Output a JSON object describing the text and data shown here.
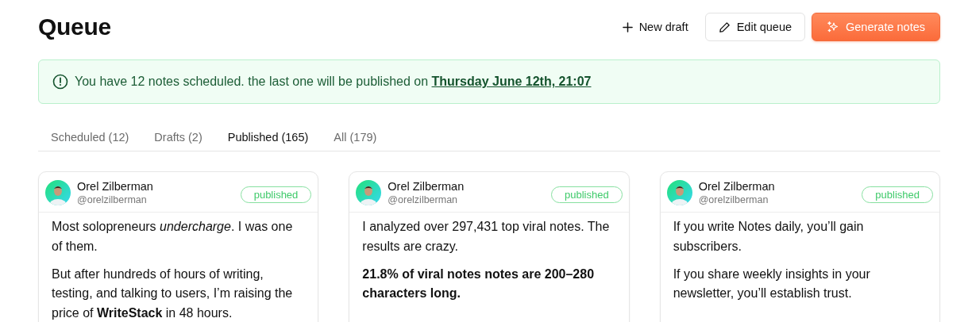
{
  "page": {
    "title": "Queue"
  },
  "actions": [
    {
      "kind": "plain",
      "label": "New draft"
    },
    {
      "kind": "outline",
      "label": "Edit queue"
    },
    {
      "kind": "primary",
      "label": "Generate notes"
    }
  ],
  "alert": {
    "text": "You have 12 notes scheduled. the last one will be published on",
    "link": "Thursday June 12th, 21:07"
  },
  "tabs": [
    {
      "label": "Scheduled (12)",
      "selected": false
    },
    {
      "label": "Drafts (2)",
      "selected": false
    },
    {
      "label": "Published (165)",
      "selected": true
    },
    {
      "label": "All (179)",
      "selected": false
    }
  ],
  "notes": [
    {
      "author": "Orel Zilberman",
      "handle": "@orelzilberman",
      "status": "published",
      "paragraphs": [
        {
          "text": "Most solopreneurs *undercharge*. I was one of them.",
          "bold": false
        },
        {
          "text": "But after hundreds of hours of writing, testing, and talking to users, I’m raising the price of **WriteStack** in 48 hours.",
          "bold": false
        }
      ]
    },
    {
      "author": "Orel Zilberman",
      "handle": "@orelzilberman",
      "status": "published",
      "paragraphs": [
        {
          "text": "I analyzed over 297,431 top viral notes. The results are crazy.",
          "bold": false
        },
        {
          "text": "21.8% of viral notes notes are 200–280 characters long.",
          "bold": true
        }
      ]
    },
    {
      "author": "Orel Zilberman",
      "handle": "@orelzilberman",
      "status": "published",
      "paragraphs": [
        {
          "text": "If you write Notes daily, you’ll gain subscribers.",
          "bold": false
        },
        {
          "text": "If you share weekly insights in your newsletter, you’ll establish trust.",
          "bold": false
        }
      ]
    }
  ]
}
